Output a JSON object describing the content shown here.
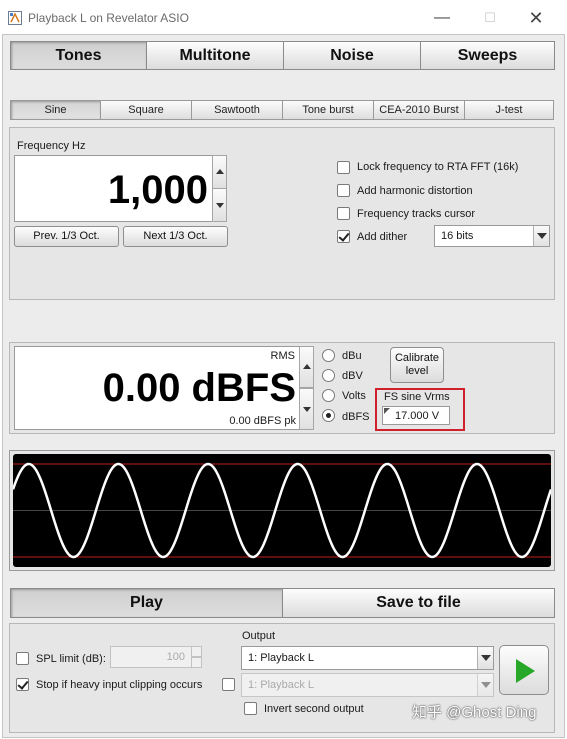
{
  "window": {
    "title": "Playback L on Revelator ASIO",
    "close_glyph": "✕",
    "min_glyph": "—",
    "max_glyph": "☐"
  },
  "top_tabs": [
    "Tones",
    "Multitone",
    "Noise",
    "Sweeps"
  ],
  "sub_tabs": [
    "Sine",
    "Square",
    "Sawtooth",
    "Tone burst",
    "CEA-2010 Burst",
    "J-test"
  ],
  "frequency": {
    "label": "Frequency Hz",
    "value": "1,000",
    "prev_button": "Prev. 1/3 Oct.",
    "next_button": "Next 1/3 Oct."
  },
  "options": {
    "lock_rta": {
      "label": "Lock frequency to RTA FFT (16k)",
      "checked": false
    },
    "harmonic": {
      "label": "Add harmonic distortion",
      "checked": false
    },
    "tracks_cursor": {
      "label": "Frequency tracks cursor",
      "checked": false
    },
    "dither": {
      "label": "Add dither",
      "checked": true
    },
    "dither_bits": "16 bits"
  },
  "level": {
    "rms_label": "RMS",
    "value": "0.00 dBFS",
    "peak": "0.00 dBFS pk",
    "units": [
      "dBu",
      "dBV",
      "Volts",
      "dBFS"
    ],
    "selected_unit": "dBFS",
    "calibrate_line1": "Calibrate",
    "calibrate_line2": "level",
    "fs_label": "FS sine Vrms",
    "fs_value": "17.000 V"
  },
  "waveform": {
    "cycles": 6,
    "background": "#000000",
    "wave_color": "#ffffff",
    "limit_color": "#c21b1b"
  },
  "actions": {
    "play": "Play",
    "save": "Save to file"
  },
  "footer": {
    "spl_label": "SPL limit (dB):",
    "spl_value": "100",
    "clip_label": "Stop if heavy input clipping occurs",
    "output_label": "Output",
    "output_primary": "1: Playback L",
    "output_secondary": "1: Playback L",
    "invert_label": "Invert second output"
  },
  "watermark": "知乎 @Ghost Ding",
  "colors": {
    "highlight": "#d0202a",
    "play_green": "#28a828"
  }
}
